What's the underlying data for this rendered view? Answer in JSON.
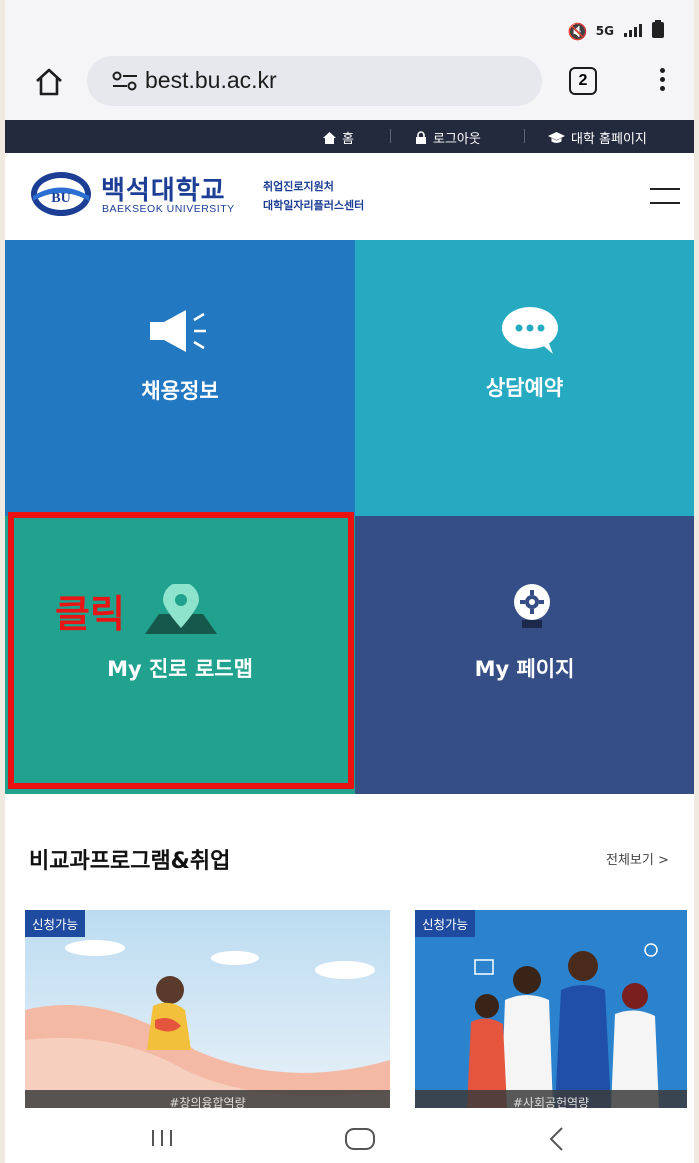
{
  "status_bar": {
    "icons": [
      "mute-icon",
      "5g-icon",
      "signal-icon",
      "battery-icon"
    ],
    "network": "5G"
  },
  "browser": {
    "url": "best.bu.ac.kr",
    "tab_count": "2"
  },
  "top_nav": {
    "home": "홈",
    "logout": "로그아웃",
    "univ_home": "대학 홈페이지"
  },
  "header": {
    "logo_mark": "BU",
    "logo_kr": "백석대학교",
    "logo_en": "BAEKSEOK UNIVERSITY",
    "sub1": "취업진로지원처",
    "sub2": "대학일자리플러스센터"
  },
  "tiles": [
    {
      "label": "채용정보",
      "icon": "megaphone-icon",
      "color": "#2379c1"
    },
    {
      "label": "상담예약",
      "icon": "chat-bubble-icon",
      "color": "#25aac2"
    },
    {
      "label": "My 진로 로드맵",
      "icon": "map-pin-icon",
      "color": "#21a28e"
    },
    {
      "label": "My 페이지",
      "icon": "gear-bulb-icon",
      "color": "#354e85"
    }
  ],
  "annotation": {
    "click_text": "클릭",
    "highlight_color": "#ec1111"
  },
  "section": {
    "title": "비교과프로그램&취업",
    "view_all": "전체보기 >"
  },
  "cards": [
    {
      "badge": "신청가능",
      "caption": "#창의융합역량"
    },
    {
      "badge": "신청가능",
      "caption": "#사회공헌역량"
    }
  ]
}
